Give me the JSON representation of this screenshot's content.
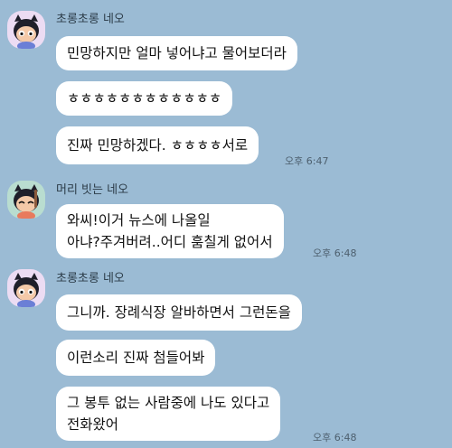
{
  "colors": {
    "background": "#9bbbd4",
    "bubble": "#ffffff",
    "text": "#111111"
  },
  "groups": [
    {
      "sender": "초롱초롱 네오",
      "avatar_icon": "neo-character-icon",
      "messages": [
        {
          "lines": [
            "민망하지만 얼마 넣어냐고 물어보더라"
          ]
        },
        {
          "lines": [
            "ㅎㅎㅎㅎㅎㅎㅎㅎㅎㅎㅎㅎ"
          ]
        },
        {
          "lines": [
            "진짜 민망하겠다. ㅎㅎㅎㅎ서로"
          ]
        }
      ],
      "time": "오후 6:47"
    },
    {
      "sender": "머리 빗는 네오",
      "avatar_icon": "neo-combing-hair-icon",
      "messages": [
        {
          "lines": [
            "와씨!이거 뉴스에 나올일",
            "아냐?주겨버려..어디 훔칠게 없어서"
          ]
        }
      ],
      "time": "오후 6:48"
    },
    {
      "sender": "초롱초롱 네오",
      "avatar_icon": "neo-character-icon",
      "messages": [
        {
          "lines": [
            "그니까. 장례식장 알바하면서 그런돈을"
          ]
        },
        {
          "lines": [
            "이런소리 진짜 첨들어봐"
          ]
        },
        {
          "lines": [
            "그 봉투 없는 사람중에 나도 있다고",
            "전화왔어"
          ]
        }
      ],
      "time": "오후 6:48"
    }
  ]
}
